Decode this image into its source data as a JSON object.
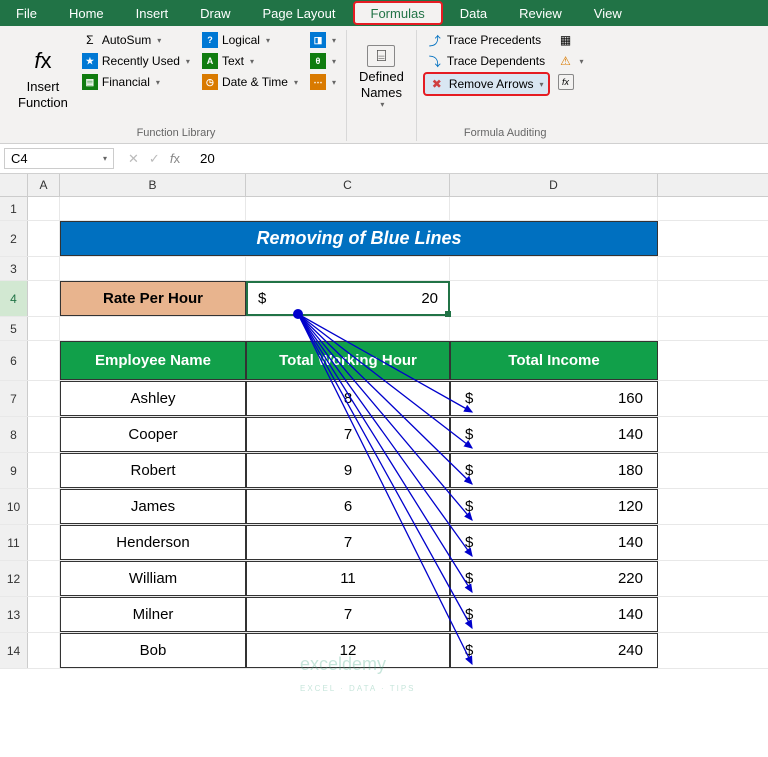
{
  "tabs": [
    "File",
    "Home",
    "Insert",
    "Draw",
    "Page Layout",
    "Formulas",
    "Data",
    "Review",
    "View"
  ],
  "activeTab": "Formulas",
  "ribbon": {
    "insertFn": "Insert\nFunction",
    "autosum": "AutoSum",
    "recent": "Recently Used",
    "financial": "Financial",
    "logical": "Logical",
    "text": "Text",
    "datetime": "Date & Time",
    "libLabel": "Function Library",
    "defNames": "Defined\nNames",
    "tracePrec": "Trace Precedents",
    "traceDep": "Trace Dependents",
    "removeArrows": "Remove Arrows",
    "auditLabel": "Formula Auditing"
  },
  "nameBox": "C4",
  "formulaBar": "20",
  "cols": [
    "A",
    "B",
    "C",
    "D"
  ],
  "title": "Removing of Blue Lines",
  "rateLabel": "Rate Per Hour",
  "rateCurrency": "$",
  "rateValue": "20",
  "headers": [
    "Employee Name",
    "Total Working Hour",
    "Total Income"
  ],
  "rows": [
    {
      "n": "7",
      "name": "Ashley",
      "hours": "8",
      "inc": "160"
    },
    {
      "n": "8",
      "name": "Cooper",
      "hours": "7",
      "inc": "140"
    },
    {
      "n": "9",
      "name": "Robert",
      "hours": "9",
      "inc": "180"
    },
    {
      "n": "10",
      "name": "James",
      "hours": "6",
      "inc": "120"
    },
    {
      "n": "11",
      "name": "Henderson",
      "hours": "7",
      "inc": "140"
    },
    {
      "n": "12",
      "name": "William",
      "hours": "11",
      "inc": "220"
    },
    {
      "n": "13",
      "name": "Milner",
      "hours": "7",
      "inc": "140"
    },
    {
      "n": "14",
      "name": "Bob",
      "hours": "12",
      "inc": "240"
    }
  ],
  "watermark": {
    "main": "exceldemy",
    "sub": "EXCEL · DATA · TIPS"
  }
}
